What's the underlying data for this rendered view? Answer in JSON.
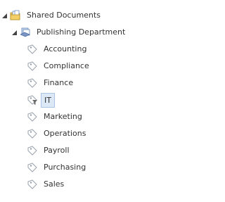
{
  "tree": {
    "root": {
      "label": "Shared Documents",
      "icon": "folder-documents-icon",
      "expanded": true
    },
    "child": {
      "label": "Publishing Department",
      "icon": "taxonomy-group-icon",
      "expanded": true
    },
    "items": [
      {
        "label": "Accounting",
        "icon": "tag-icon"
      },
      {
        "label": "Compliance",
        "icon": "tag-icon"
      },
      {
        "label": "Finance",
        "icon": "tag-icon"
      },
      {
        "label": "IT",
        "icon": "tag-filter-icon",
        "selected": true
      },
      {
        "label": "Marketing",
        "icon": "tag-icon"
      },
      {
        "label": "Operations",
        "icon": "tag-icon"
      },
      {
        "label": "Payroll",
        "icon": "tag-icon"
      },
      {
        "label": "Purchasing",
        "icon": "tag-icon"
      },
      {
        "label": "Sales",
        "icon": "tag-icon"
      }
    ]
  },
  "colors": {
    "selection_bg": "#dde8f6",
    "selection_border": "#a9c4e4",
    "text": "#333333"
  }
}
